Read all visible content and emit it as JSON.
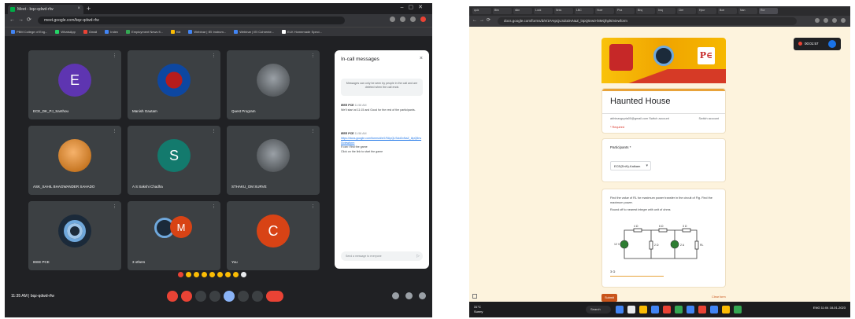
{
  "meet": {
    "tab_title": "Meet - bqz-qdwd-rfw",
    "url": "meet.google.com/bqz-qdwd-rfw",
    "bookmarks": [
      "PBM College of Eng...",
      "WhatsApp",
      "Gmail",
      "Index",
      "Employment News fi...",
      "Kiit",
      "Webinar | IEI Instrum...",
      "Webinar | IEI Cohrente...",
      "ELK Homemade Speci..."
    ],
    "tiles": [
      {
        "name": "ECE_DK_PJ_Santhou",
        "letter": "E"
      },
      {
        "name": "Manish Gautam",
        "letter": ""
      },
      {
        "name": "Quest Program",
        "letter": ""
      },
      {
        "name": "ASK_SAHIL BHAGWANDER SAHADO",
        "letter": ""
      },
      {
        "name": "A S Sakshi Chadha",
        "letter": "S"
      },
      {
        "name": "STHAKU_OM SURVE",
        "letter": ""
      },
      {
        "name": "IEEE PCE",
        "letter": ""
      },
      {
        "name": "3 others",
        "letter": "M"
      },
      {
        "name": "You",
        "letter": "C"
      }
    ],
    "chat": {
      "title": "In-call messages",
      "close": "×",
      "note": "Messages can only be seen by people in the call and are deleted when the call ends",
      "messages": [
        {
          "sender": "IEEE PCE",
          "time": "11:58 AM",
          "text": "We'll start at 11:15 and Good for the rest of the participants."
        },
        {
          "sender": "IEEE PCE",
          "time": "11:58 AM",
          "link": "https://docs.google.com/forms/d/e/1FAIpQLSdoDvNaZ_l4pQ5rw0/viewform",
          "after": "If can t find the game",
          "after2": "Click on the link to start the game"
        }
      ],
      "input_placeholder": "Send a message to everyone",
      "send_icon": "▷"
    },
    "clock": "11:35 AM  |  bqz-qdwd-rfw"
  },
  "form": {
    "tabs": [
      "quiz",
      "Bfw",
      "slkn",
      "Lock",
      "Nnts",
      "LBC",
      "Hoer",
      "Pha",
      "Bhq",
      "Imq",
      "Cler",
      "Hpcr",
      "Boe",
      "Nan",
      "Ror"
    ],
    "url": "docs.google.com/forms/d/e/1FAIpQLSdoDvNaZ_l4pQ5rw0-l8MQhpl6/viewform",
    "rec_time": "00:01:57",
    "banner_right": "P∈",
    "title": "Haunted House",
    "account": "abhinavgupta00@gmail.com  Switch account",
    "switch_label": "Switch account",
    "required_note": "* Required",
    "participants_label": "Participants *",
    "participants_value": "ECE(EnN)-Kalkam",
    "question_text": "Find the value of RL for maximum power transfer in the circuit of Fig. Find the maximum power.",
    "question_note": "Round off to nearest integer with unit of ohms",
    "circuit_labels": [
      "4 Ω",
      "6 Ω",
      "3 Ω",
      "12 V",
      "2 Ω",
      "2 A",
      "RL"
    ],
    "answer": "3 Ω",
    "submit": "Submit",
    "clear": "Clear form",
    "weather": "31°C\nSunny",
    "taskbar_search": "Search",
    "tray": "ENG 11:04 18-01-2023"
  },
  "colors": {
    "meet_bg": "#202124",
    "form_bg": "#fdf3dd",
    "accent": "#e8a33a",
    "end_call": "#ea4335"
  }
}
